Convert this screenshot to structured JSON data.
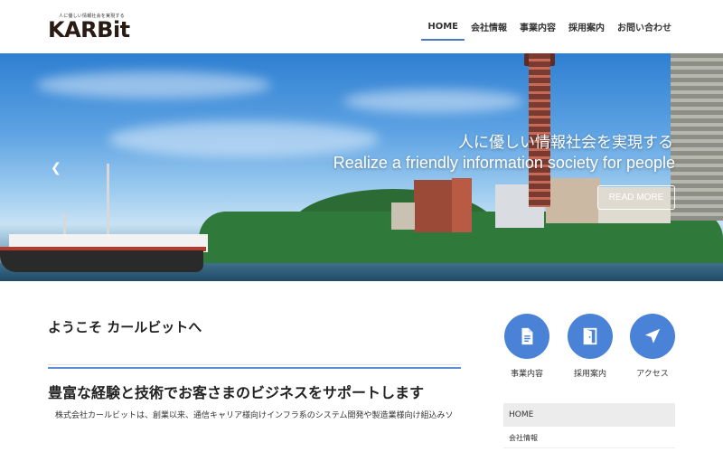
{
  "header": {
    "logo_tagline": "人に優しい情報社会を実現する",
    "logo_text": "KARBit",
    "nav": [
      {
        "label": "HOME",
        "active": true
      },
      {
        "label": "会社情報",
        "active": false
      },
      {
        "label": "事業内容",
        "active": false
      },
      {
        "label": "採用案内",
        "active": false
      },
      {
        "label": "お問い合わせ",
        "active": false
      }
    ]
  },
  "hero": {
    "title_ja": "人に優しい情報社会を実現する",
    "title_en": "Realize a friendly information society for people",
    "read_more": "READ MORE",
    "prev_icon": "chevron-left-icon"
  },
  "main": {
    "welcome": "ようこそ カールビットへ",
    "headline": "豊富な経験と技術でお客さまのビジネスをサポートします",
    "body": "株式会社カールビットは、創業以来、通信キャリア様向けインフラ系のシステム開発や製造業様向け組込みソ"
  },
  "sidebar": {
    "icons": [
      {
        "label": "事業内容",
        "icon": "document-icon"
      },
      {
        "label": "採用案内",
        "icon": "door-icon"
      },
      {
        "label": "アクセス",
        "icon": "location-arrow-icon"
      }
    ],
    "menu": [
      {
        "label": "HOME"
      },
      {
        "label": "会社情報"
      }
    ]
  },
  "colors": {
    "accent": "#4a82d8",
    "nav_underline": "#4b78c8",
    "logo_dot": "#e8472c"
  }
}
